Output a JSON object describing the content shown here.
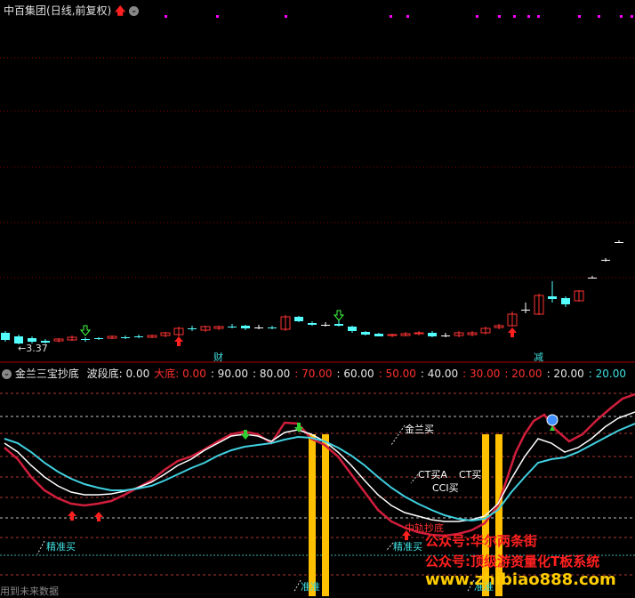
{
  "main_panel": {
    "stock_name": "中百集团",
    "period_label": "(日线,前复权)",
    "low_price_label": "←3.37",
    "markers": [
      "财",
      "减"
    ]
  },
  "indicator_panel": {
    "name": "金兰三宝抄底",
    "values": [
      {
        "label": "波段底:",
        "value": "0.00",
        "color": "#e8e8e8"
      },
      {
        "label": "大底:",
        "value": "0.00",
        "color": "#ff3030"
      },
      {
        "label": "",
        "value": ": 90.00",
        "color": "#e8e8e8"
      },
      {
        "label": "",
        "value": ": 80.00",
        "color": "#e8e8e8"
      },
      {
        "label": "",
        "value": ": 70.00",
        "color": "#ff3030"
      },
      {
        "label": "",
        "value": ": 60.00",
        "color": "#e8e8e8"
      },
      {
        "label": "",
        "value": ": 50.00",
        "color": "#ff3030"
      },
      {
        "label": "",
        "value": ": 40.00",
        "color": "#e8e8e8"
      },
      {
        "label": "",
        "value": ": 30.00",
        "color": "#ff3030"
      },
      {
        "label": "",
        "value": ": 20.00",
        "color": "#ff3030"
      },
      {
        "label": "",
        "value": ": 20.00",
        "color": "#e8e8e8"
      },
      {
        "label": "",
        "value": ": 20.00",
        "color": "#40e0e0"
      }
    ],
    "annotations": {
      "jinlan_buy": "金兰买",
      "ct_buy_a": "CT买A",
      "ct_buy": "CT买",
      "cci_buy": "CCI买",
      "precise_buy_left": "精准买",
      "precise_buy_right": "精准买",
      "bottom_label": "中轨抄底",
      "accurate_label": "准准",
      "accurate_label_2": "准准"
    },
    "footer_text": "用到未来数据"
  },
  "watermarks": {
    "line1": "公众号:华尔两条街",
    "line2": "公众号:顶级游资量化T板系统",
    "line3": "www.zhibiao888.com"
  },
  "colors": {
    "up": "#ff3232",
    "down": "#54ffff",
    "line_red": "#d01e3c",
    "line_white": "#ffffff",
    "line_cyan": "#40d0e0",
    "bar_yellow": "#ffc000",
    "grid_red": "#8a0000",
    "magenta": "#ff00ff"
  }
}
